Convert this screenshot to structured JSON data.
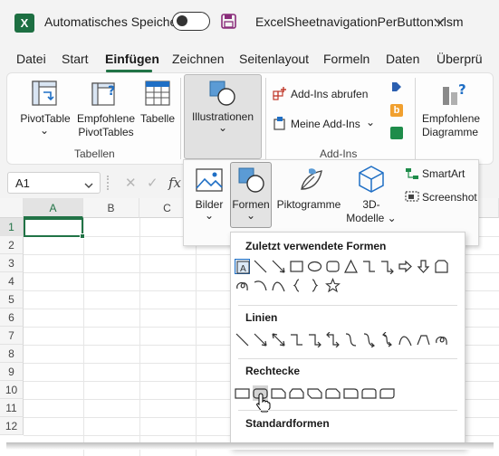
{
  "titlebar": {
    "app_icon_letter": "X",
    "autosave_label": "Automatisches Speichern",
    "file_name": "ExcelSheetnavigationPerButton.xlsm"
  },
  "tabs": [
    "Datei",
    "Start",
    "Einfügen",
    "Zeichnen",
    "Seitenlayout",
    "Formeln",
    "Daten",
    "Überprü"
  ],
  "active_tab": "Einfügen",
  "ribbon": {
    "pivottable": "PivotTable",
    "empfohlene_pivottables_1": "Empfohlene",
    "empfohlene_pivottables_2": "PivotTables",
    "tabelle": "Tabelle",
    "tabellen_group": "Tabellen",
    "illustrationen": "Illustrationen",
    "addins_abrufen": "Add-Ins abrufen",
    "meine_addins": "Meine Add-Ins",
    "addins_group": "Add-Ins",
    "empfohlene_diagramme_1": "Empfohlene",
    "empfohlene_diagramme_2": "Diagramme"
  },
  "formula_bar": {
    "name_box": "A1",
    "cancel_glyph": "✕",
    "enter_glyph": "✓",
    "fx": "fx"
  },
  "grid": {
    "columns": [
      "A",
      "B",
      "C"
    ],
    "rows": [
      "1",
      "2",
      "3",
      "4",
      "5",
      "6",
      "7",
      "8",
      "9",
      "10",
      "11",
      "12"
    ]
  },
  "illustrationen_panel": {
    "bilder": "Bilder",
    "formen": "Formen",
    "piktogramme": "Piktogramme",
    "modelle_1": "3D-",
    "modelle_2": "Modelle",
    "smartart": "SmartArt",
    "screenshot": "Screenshot"
  },
  "shapes_menu": {
    "recent_title": "Zuletzt verwendete Formen",
    "lines_title": "Linien",
    "rectangles_title": "Rechtecke",
    "standard_title": "Standardformen"
  },
  "colors": {
    "excel_green": "#217346",
    "accent_blue": "#1f6fc5"
  }
}
